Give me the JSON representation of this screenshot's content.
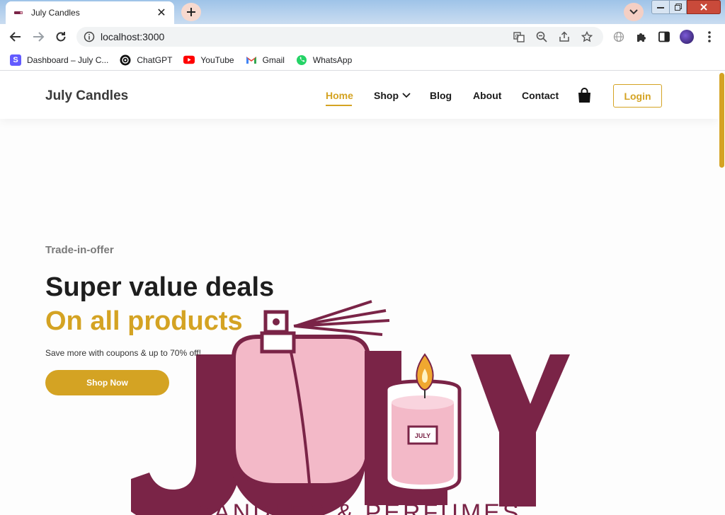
{
  "browser": {
    "tab": {
      "title": "July Candles"
    },
    "address": {
      "url": "localhost:3000"
    },
    "bookmarks": [
      {
        "label": "Dashboard – July C...",
        "icon": "stripe-s-icon",
        "color": "#635bff"
      },
      {
        "label": "ChatGPT",
        "icon": "chatgpt-icon",
        "color": "#000000"
      },
      {
        "label": "YouTube",
        "icon": "youtube-icon",
        "color": "#ff0000"
      },
      {
        "label": "Gmail",
        "icon": "gmail-icon",
        "color": "#ea4335"
      },
      {
        "label": "WhatsApp",
        "icon": "whatsapp-icon",
        "color": "#25d366"
      }
    ]
  },
  "site": {
    "brand": "July Candles",
    "nav": {
      "home": "Home",
      "shop": "Shop",
      "blog": "Blog",
      "about": "About",
      "contact": "Contact"
    },
    "login_label": "Login",
    "accent": "#d4a323"
  },
  "hero": {
    "eyebrow": "Trade-in-offer",
    "headline_1": "Super value deals",
    "headline_2": "On all products",
    "subtext": "Save more with coupons & up to 70% off!",
    "cta": "Shop Now"
  },
  "logo": {
    "text_main": "J LY",
    "text_sub": "CANDLES & PERFUMES",
    "label_text": "JULY",
    "colors": {
      "maroon": "#7a2447",
      "pink": "#f3b9c8",
      "flame": "#f0a830"
    }
  }
}
